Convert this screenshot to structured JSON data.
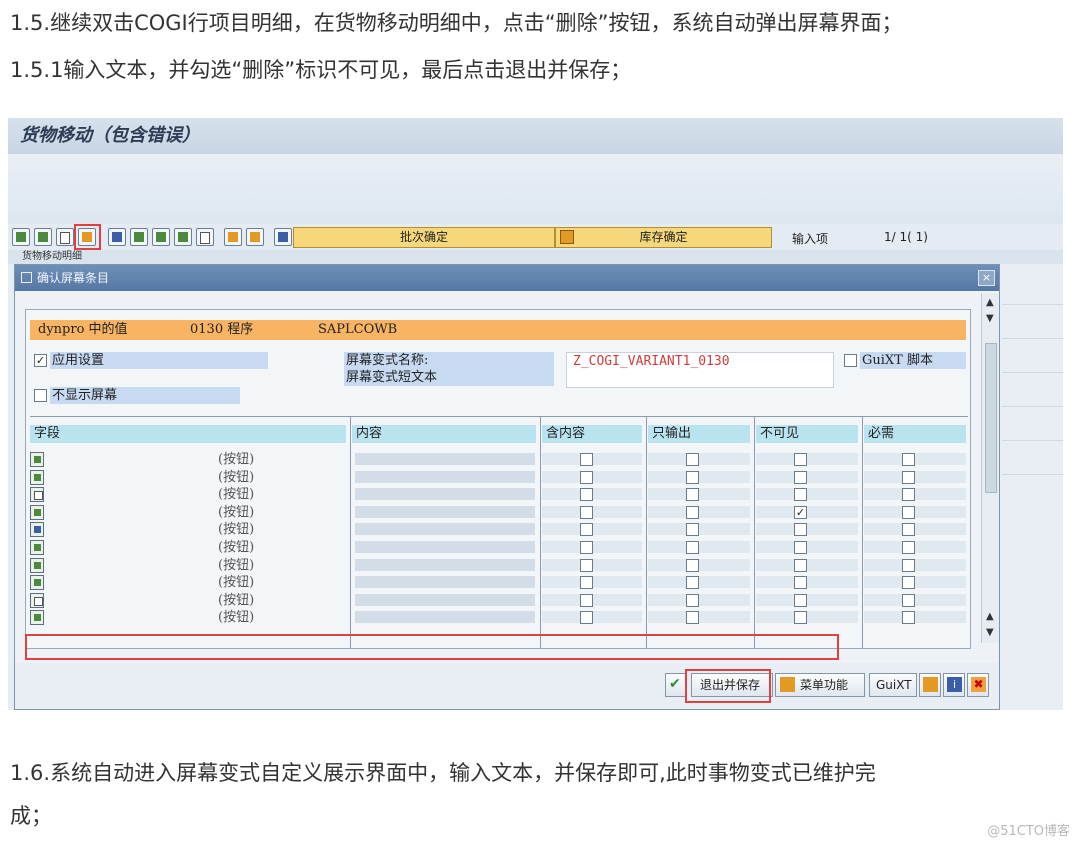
{
  "article": {
    "line1": "1.5.继续双击COGI行项目明细，在货物移动明细中，点击“删除”按钮，系统自动弹出屏幕界面；",
    "line2": "1.5.1输入文本，并勾选“删除”标识不可见，最后点击退出并保存；",
    "line3": "1.6.系统自动进入屏幕变式自定义展示界面中，输入文本，并保存即可,此时事物变式已维护完",
    "line4": "成；",
    "watermark": "@51CTO博客"
  },
  "sap": {
    "window_title": "货物移动（包含错误）",
    "toolbar": {
      "batch_label": "批次确定",
      "stock_label": "库存确定",
      "entry_label": "输入项",
      "entry_count": "1/ 1( 1)"
    },
    "subtitle": "货物移动明细",
    "dialog": {
      "title": "确认屏幕条目",
      "dynpro_label": "dynpro 中的值",
      "dynpro_value": "0130 程序",
      "program": "SAPLCOWB",
      "apply_settings": "应用设置",
      "apply_settings_checked": true,
      "hide_screen": "不显示屏幕",
      "hide_screen_checked": false,
      "variant_name_label": "屏幕变式名称:",
      "variant_short_text_label": "屏幕变式短文本",
      "variant_name_value": "Z_COGI_VARIANT1_0130",
      "guixt_script": "GuiXT 脚本",
      "guixt_checked": false,
      "columns": [
        "字段",
        "内容",
        "含内容",
        "只输出",
        "不可见",
        "必需"
      ],
      "rows": [
        {
          "icon": "doc-arrow-icon",
          "label": "(按钮)",
          "invisible": false
        },
        {
          "icon": "doc-arrow-icon",
          "label": "(按钮)",
          "invisible": false
        },
        {
          "icon": "doc-icon",
          "label": "(按钮)",
          "invisible": false
        },
        {
          "icon": "delete-row-icon",
          "label": "(按钮)",
          "invisible": true
        },
        {
          "icon": "binoculars-icon",
          "label": "(按钮)",
          "invisible": false
        },
        {
          "icon": "sort-asc-icon",
          "label": "(按钮)",
          "invisible": false
        },
        {
          "icon": "sort-desc-icon",
          "label": "(按钮)",
          "invisible": false
        },
        {
          "icon": "filter-icon",
          "label": "(按钮)",
          "invisible": false
        },
        {
          "icon": "page-icon",
          "label": "(按钮)",
          "invisible": false
        },
        {
          "icon": "hierarchy-icon",
          "label": "(按钮)",
          "invisible": false
        }
      ],
      "footer": {
        "exit_save": "退出并保存",
        "menu_func": "菜单功能",
        "guixt": "GuiXT"
      }
    }
  },
  "colors": {
    "highlight": "#e04040",
    "orange_bar": "#f8b463",
    "label_blue": "#c7daf1",
    "header_cyan": "#b9e3ef",
    "title_bar": "#5577a3"
  }
}
